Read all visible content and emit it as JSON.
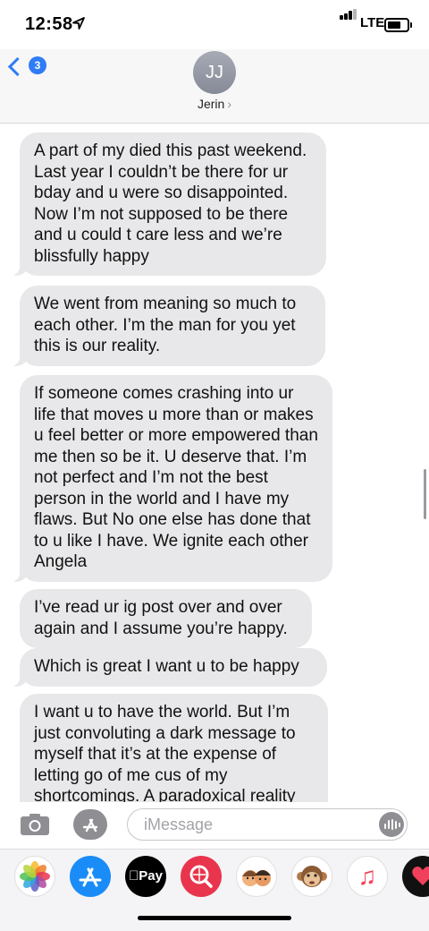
{
  "status_bar": {
    "time": "12:58",
    "network": "LTE",
    "icons": [
      "location-arrow-icon",
      "signal-icon",
      "battery-icon"
    ]
  },
  "header": {
    "back_badge": "3",
    "avatar_initials": "JJ",
    "contact_name": "Jerin",
    "contact_arrow": "›"
  },
  "messages": [
    "A part of my died this past weekend. Last year I couldn’t be there for ur bday and u were so disappointed. Now I’m not supposed to be there and u could t care less and we’re blissfully happy",
    "We went from meaning so much to each other. I’m the man for you yet this is our reality.",
    "If someone comes crashing into ur life that moves u more than or makes u feel better or more empowered than me then so be it. U deserve that. I’m not perfect and I’m not the best person in the world and I have my flaws. But No one else has done that to u like I have. We ignite each other Angela",
    "I’ve read ur ig post over and over again and I assume you’re happy.",
    "Which is great I want u to be happy",
    "I want u to have the world. But I’m just convoluting a dark message to myself that it’s at the expense of letting go of me cus of my shortcomings. A paradoxical reality"
  ],
  "input": {
    "placeholder": "iMessage"
  },
  "app_drawer": {
    "apple_pay_label": "Pay",
    "apps": [
      "photos-icon",
      "app-store-icon",
      "apple-pay-icon",
      "web-images-icon",
      "memoji-stickers-icon",
      "animoji-icon",
      "music-icon",
      "digital-touch-icon"
    ]
  },
  "colors": {
    "accent": "#2f7cf6",
    "bubble_received": "#e8e8ea",
    "badge": "#2f7cf6"
  }
}
